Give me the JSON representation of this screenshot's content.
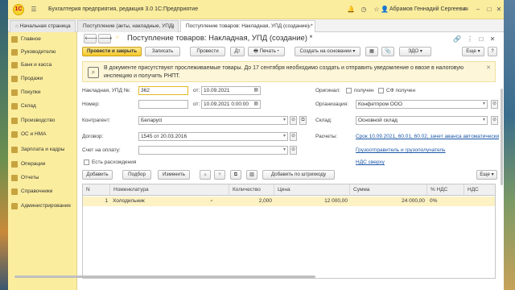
{
  "titlebar": {
    "logo_text": "1С",
    "title": "Бухгалтерия предприятия, редакция 3.0 1С:Предприятие",
    "user": "Абрамов Геннадий Сергеевич"
  },
  "tabs": [
    {
      "label": "Начальная страница"
    },
    {
      "label": "Поступление (акты, накладные, УПД)"
    },
    {
      "label": "Поступление товаров: Накладная, УПД (создание) *"
    }
  ],
  "sidebar": {
    "items": [
      {
        "label": "Главное"
      },
      {
        "label": "Руководителю"
      },
      {
        "label": "Банк и касса"
      },
      {
        "label": "Продажи"
      },
      {
        "label": "Покупки"
      },
      {
        "label": "Склад"
      },
      {
        "label": "Производство"
      },
      {
        "label": "ОС и НМА"
      },
      {
        "label": "Зарплата и кадры"
      },
      {
        "label": "Операции"
      },
      {
        "label": "Отчеты"
      },
      {
        "label": "Справочники"
      },
      {
        "label": "Администрирование"
      }
    ]
  },
  "form": {
    "title": "Поступление товаров: Накладная, УПД (создание) *",
    "toolbar": {
      "post_close": "Провести и закрыть",
      "write": "Записать",
      "post": "Провести",
      "print": "Печать",
      "create_based": "Создать на основании",
      "edo": "ЭДО",
      "more": "Еще",
      "help": "?"
    },
    "notice": "В документе присутствуют прослеживаемые товары. До 17 сентября необходимо создать и отправить уведомление о ввозе в налоговую инспекцию и получить РНПТ.",
    "doc_number_label": "Накладная, УПД №:",
    "doc_number": "362",
    "from_label": "от:",
    "doc_date": "10.09.2021",
    "number_label": "Номер:",
    "number_value": "",
    "from2_label": "от:",
    "date2": "10.09.2021  0:00:00",
    "original_label": "Оригинал:",
    "received_label": "получен",
    "sf_received_label": "СФ получен",
    "org_label": "Организация:",
    "org": "Конфетпром ООО",
    "contractor_label": "Контрагент:",
    "contractor": "Беларусі",
    "warehouse_label": "Склад:",
    "warehouse": "Основной склад",
    "contract_label": "Договор:",
    "contract": "1545 от 20.03.2016",
    "settlements_label": "Расчеты:",
    "settlements_link": "Срок 10.09.2021, 60.01, 60.02, зачет аванса автоматически",
    "invoice_label": "Счет на оплату:",
    "invoice": "",
    "shipper_link": "Грузоотправитель и грузополучатель",
    "discrepancy_label": "Есть расхождения",
    "vat_link": "НДС сверху"
  },
  "table_toolbar": {
    "add": "Добавить",
    "pick": "Подбор",
    "change": "Изменить",
    "barcode": "Добавить по штрихкоду",
    "more": "Еще"
  },
  "table": {
    "headers": [
      "N",
      "Номенклатура",
      "Количество",
      "Цена",
      "Сумма",
      "% НДС",
      "НДС"
    ],
    "rows": [
      {
        "n": "1",
        "item": "Холодильник",
        "qty": "2,000",
        "price": "12 000,00",
        "sum": "24 000,00",
        "vat_rate": "0%",
        "vat": ""
      }
    ]
  },
  "colors": {
    "accent_yellow": "#fbed9e",
    "primary_button": "#f5c72a",
    "link": "#1a56a6",
    "row_highlight": "#fdf2c4"
  }
}
